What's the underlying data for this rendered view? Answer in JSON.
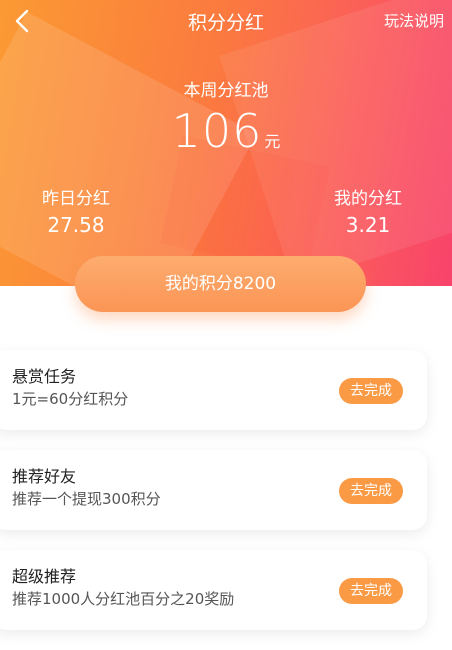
{
  "nav": {
    "title": "积分分红",
    "rules_link": "玩法说明",
    "back_icon": "chevron-left-icon"
  },
  "pool": {
    "label": "本周分红池",
    "amount": "106",
    "unit": "元"
  },
  "stats": {
    "yesterday_label": "昨日分红",
    "yesterday_value": "27.58",
    "mine_label": "我的分红",
    "mine_value": "3.21"
  },
  "points": {
    "text": "我的积分8200"
  },
  "tasks": [
    {
      "title": "悬赏任务",
      "subtitle": "1元=60分红积分",
      "button": "去完成"
    },
    {
      "title": "推荐好友",
      "subtitle": "推荐一个提现300积分",
      "button": "去完成"
    },
    {
      "title": "超级推荐",
      "subtitle": "推荐1000人分红池百分之20奖励",
      "button": "去完成"
    }
  ],
  "colors": {
    "gradient_start": "#fb9a33",
    "gradient_end": "#f8436a",
    "button": "#fb9a45"
  }
}
